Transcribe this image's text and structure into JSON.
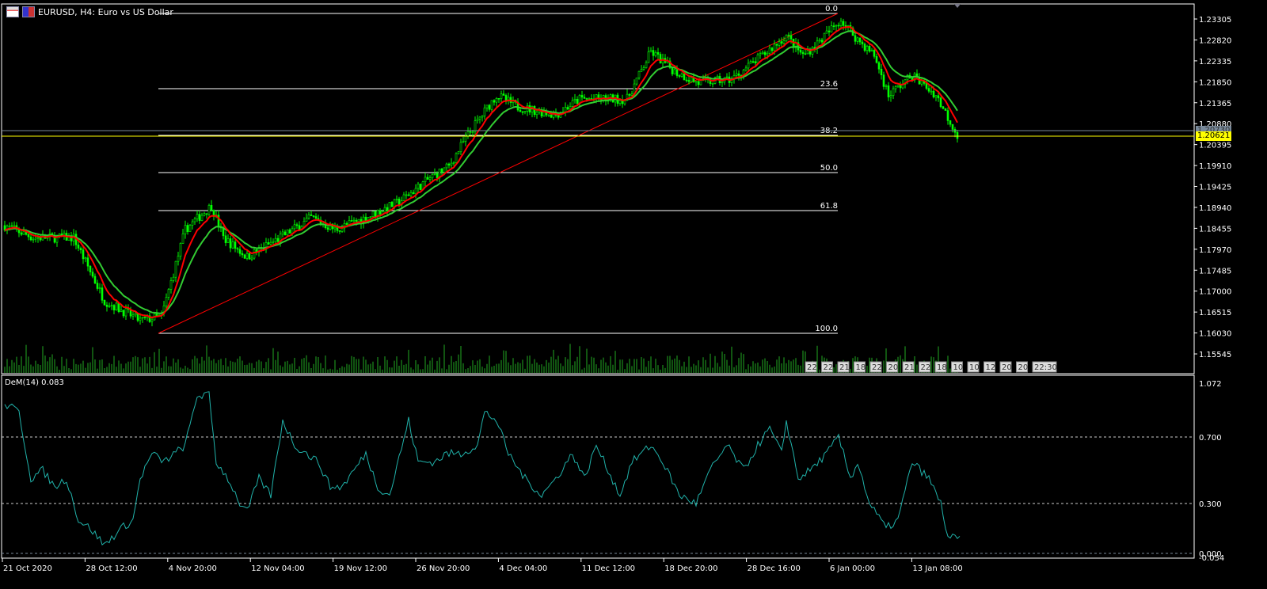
{
  "window": {
    "title": "EURUSD, H4:  Euro vs US Dollar"
  },
  "price_axis": {
    "ticks": [
      "1.23305",
      "1.22820",
      "1.22335",
      "1.21850",
      "1.21365",
      "1.20880",
      "1.20395",
      "1.19910",
      "1.19425",
      "1.18940",
      "1.18455",
      "1.17970",
      "1.17485",
      "1.17000",
      "1.16515",
      "1.16030",
      "1.15545"
    ],
    "bid_label": "1.20621",
    "ask_label": "1.20730"
  },
  "fibonacci": {
    "levels": [
      "0.0",
      "23.6",
      "38.2",
      "50.0",
      "61.8",
      "100.0"
    ]
  },
  "indicator": {
    "label": "DeM(14) 0.083",
    "ticks": [
      "1.072",
      "0.700",
      "0.300",
      "0.000",
      "-0.054"
    ]
  },
  "time_axis": {
    "labels": [
      "21 Oct 2020",
      "28 Oct 12:00",
      "4 Nov 20:00",
      "12 Nov 04:00",
      "19 Nov 12:00",
      "26 Nov 20:00",
      "4 Dec 04:00",
      "11 Dec 12:00",
      "18 Dec 20:00",
      "28 Dec 16:00",
      "6 Jan 00:00",
      "13 Jan 08:00"
    ]
  },
  "period_markers": [
    "22",
    "22",
    "21",
    "18",
    "22",
    "20",
    "21",
    "22",
    "18",
    "10",
    "10",
    "12",
    "20",
    "20",
    "22:30"
  ],
  "colors": {
    "bull": "#00ff00",
    "ma_fast": "#ff0000",
    "ma_slow": "#32cd32",
    "dem": "#20b2aa",
    "bid": "#ffff00",
    "trend": "#ff0000"
  },
  "chart_data": {
    "type": "candlestick",
    "symbol": "EURUSD",
    "timeframe": "H4",
    "price_path": [
      [
        1,
        1.1852
      ],
      [
        13,
        1.1824
      ],
      [
        30,
        1.1824
      ],
      [
        43,
        1.1678
      ],
      [
        58,
        1.1632
      ],
      [
        67,
        1.1641
      ],
      [
        77,
        1.1843
      ],
      [
        88,
        1.1898
      ],
      [
        93,
        1.1824
      ],
      [
        103,
        1.1779
      ],
      [
        117,
        1.1824
      ],
      [
        130,
        1.187
      ],
      [
        140,
        1.1843
      ],
      [
        153,
        1.187
      ],
      [
        167,
        1.1907
      ],
      [
        180,
        1.1962
      ],
      [
        188,
        1.1989
      ],
      [
        195,
        1.2054
      ],
      [
        202,
        1.2109
      ],
      [
        208,
        1.2154
      ],
      [
        217,
        1.2127
      ],
      [
        233,
        1.2109
      ],
      [
        243,
        1.2145
      ],
      [
        263,
        1.2145
      ],
      [
        273,
        1.2255
      ],
      [
        283,
        1.2209
      ],
      [
        293,
        1.2182
      ],
      [
        307,
        1.2191
      ],
      [
        320,
        1.2246
      ],
      [
        330,
        1.2292
      ],
      [
        337,
        1.2246
      ],
      [
        343,
        1.2274
      ],
      [
        353,
        1.2329
      ],
      [
        360,
        1.2283
      ],
      [
        367,
        1.2246
      ],
      [
        373,
        1.2154
      ],
      [
        383,
        1.22
      ],
      [
        393,
        1.2154
      ],
      [
        402,
        1.2062
      ]
    ],
    "dem_path": [
      [
        1,
        0.9
      ],
      [
        7,
        0.85
      ],
      [
        12,
        0.45
      ],
      [
        17,
        0.5
      ],
      [
        22,
        0.4
      ],
      [
        27,
        0.45
      ],
      [
        32,
        0.2
      ],
      [
        37,
        0.15
      ],
      [
        43,
        0.05
      ],
      [
        50,
        0.15
      ],
      [
        55,
        0.2
      ],
      [
        58,
        0.45
      ],
      [
        63,
        0.6
      ],
      [
        68,
        0.55
      ],
      [
        77,
        0.65
      ],
      [
        82,
        0.95
      ],
      [
        87,
        0.95
      ],
      [
        90,
        0.55
      ],
      [
        95,
        0.45
      ],
      [
        100,
        0.3
      ],
      [
        103,
        0.25
      ],
      [
        108,
        0.45
      ],
      [
        113,
        0.35
      ],
      [
        118,
        0.8
      ],
      [
        123,
        0.65
      ],
      [
        128,
        0.6
      ],
      [
        133,
        0.55
      ],
      [
        138,
        0.4
      ],
      [
        143,
        0.4
      ],
      [
        148,
        0.5
      ],
      [
        153,
        0.6
      ],
      [
        158,
        0.4
      ],
      [
        163,
        0.35
      ],
      [
        171,
        0.8
      ],
      [
        175,
        0.55
      ],
      [
        182,
        0.55
      ],
      [
        187,
        0.6
      ],
      [
        193,
        0.6
      ],
      [
        200,
        0.65
      ],
      [
        203,
        0.85
      ],
      [
        208,
        0.8
      ],
      [
        213,
        0.6
      ],
      [
        220,
        0.45
      ],
      [
        227,
        0.35
      ],
      [
        233,
        0.45
      ],
      [
        240,
        0.6
      ],
      [
        245,
        0.45
      ],
      [
        250,
        0.65
      ],
      [
        255,
        0.5
      ],
      [
        260,
        0.35
      ],
      [
        265,
        0.55
      ],
      [
        273,
        0.65
      ],
      [
        278,
        0.55
      ],
      [
        285,
        0.35
      ],
      [
        292,
        0.3
      ],
      [
        298,
        0.5
      ],
      [
        305,
        0.65
      ],
      [
        312,
        0.5
      ],
      [
        318,
        0.65
      ],
      [
        323,
        0.75
      ],
      [
        328,
        0.6
      ],
      [
        330,
        0.8
      ],
      [
        335,
        0.45
      ],
      [
        340,
        0.5
      ],
      [
        347,
        0.6
      ],
      [
        352,
        0.7
      ],
      [
        357,
        0.45
      ],
      [
        360,
        0.55
      ],
      [
        365,
        0.3
      ],
      [
        372,
        0.15
      ],
      [
        377,
        0.2
      ],
      [
        383,
        0.55
      ],
      [
        390,
        0.45
      ],
      [
        395,
        0.3
      ],
      [
        398,
        0.1
      ],
      [
        403,
        0.083
      ]
    ],
    "price_range": [
      1.153,
      1.2355
    ],
    "dem_range": [
      -0.054,
      1.072
    ]
  }
}
